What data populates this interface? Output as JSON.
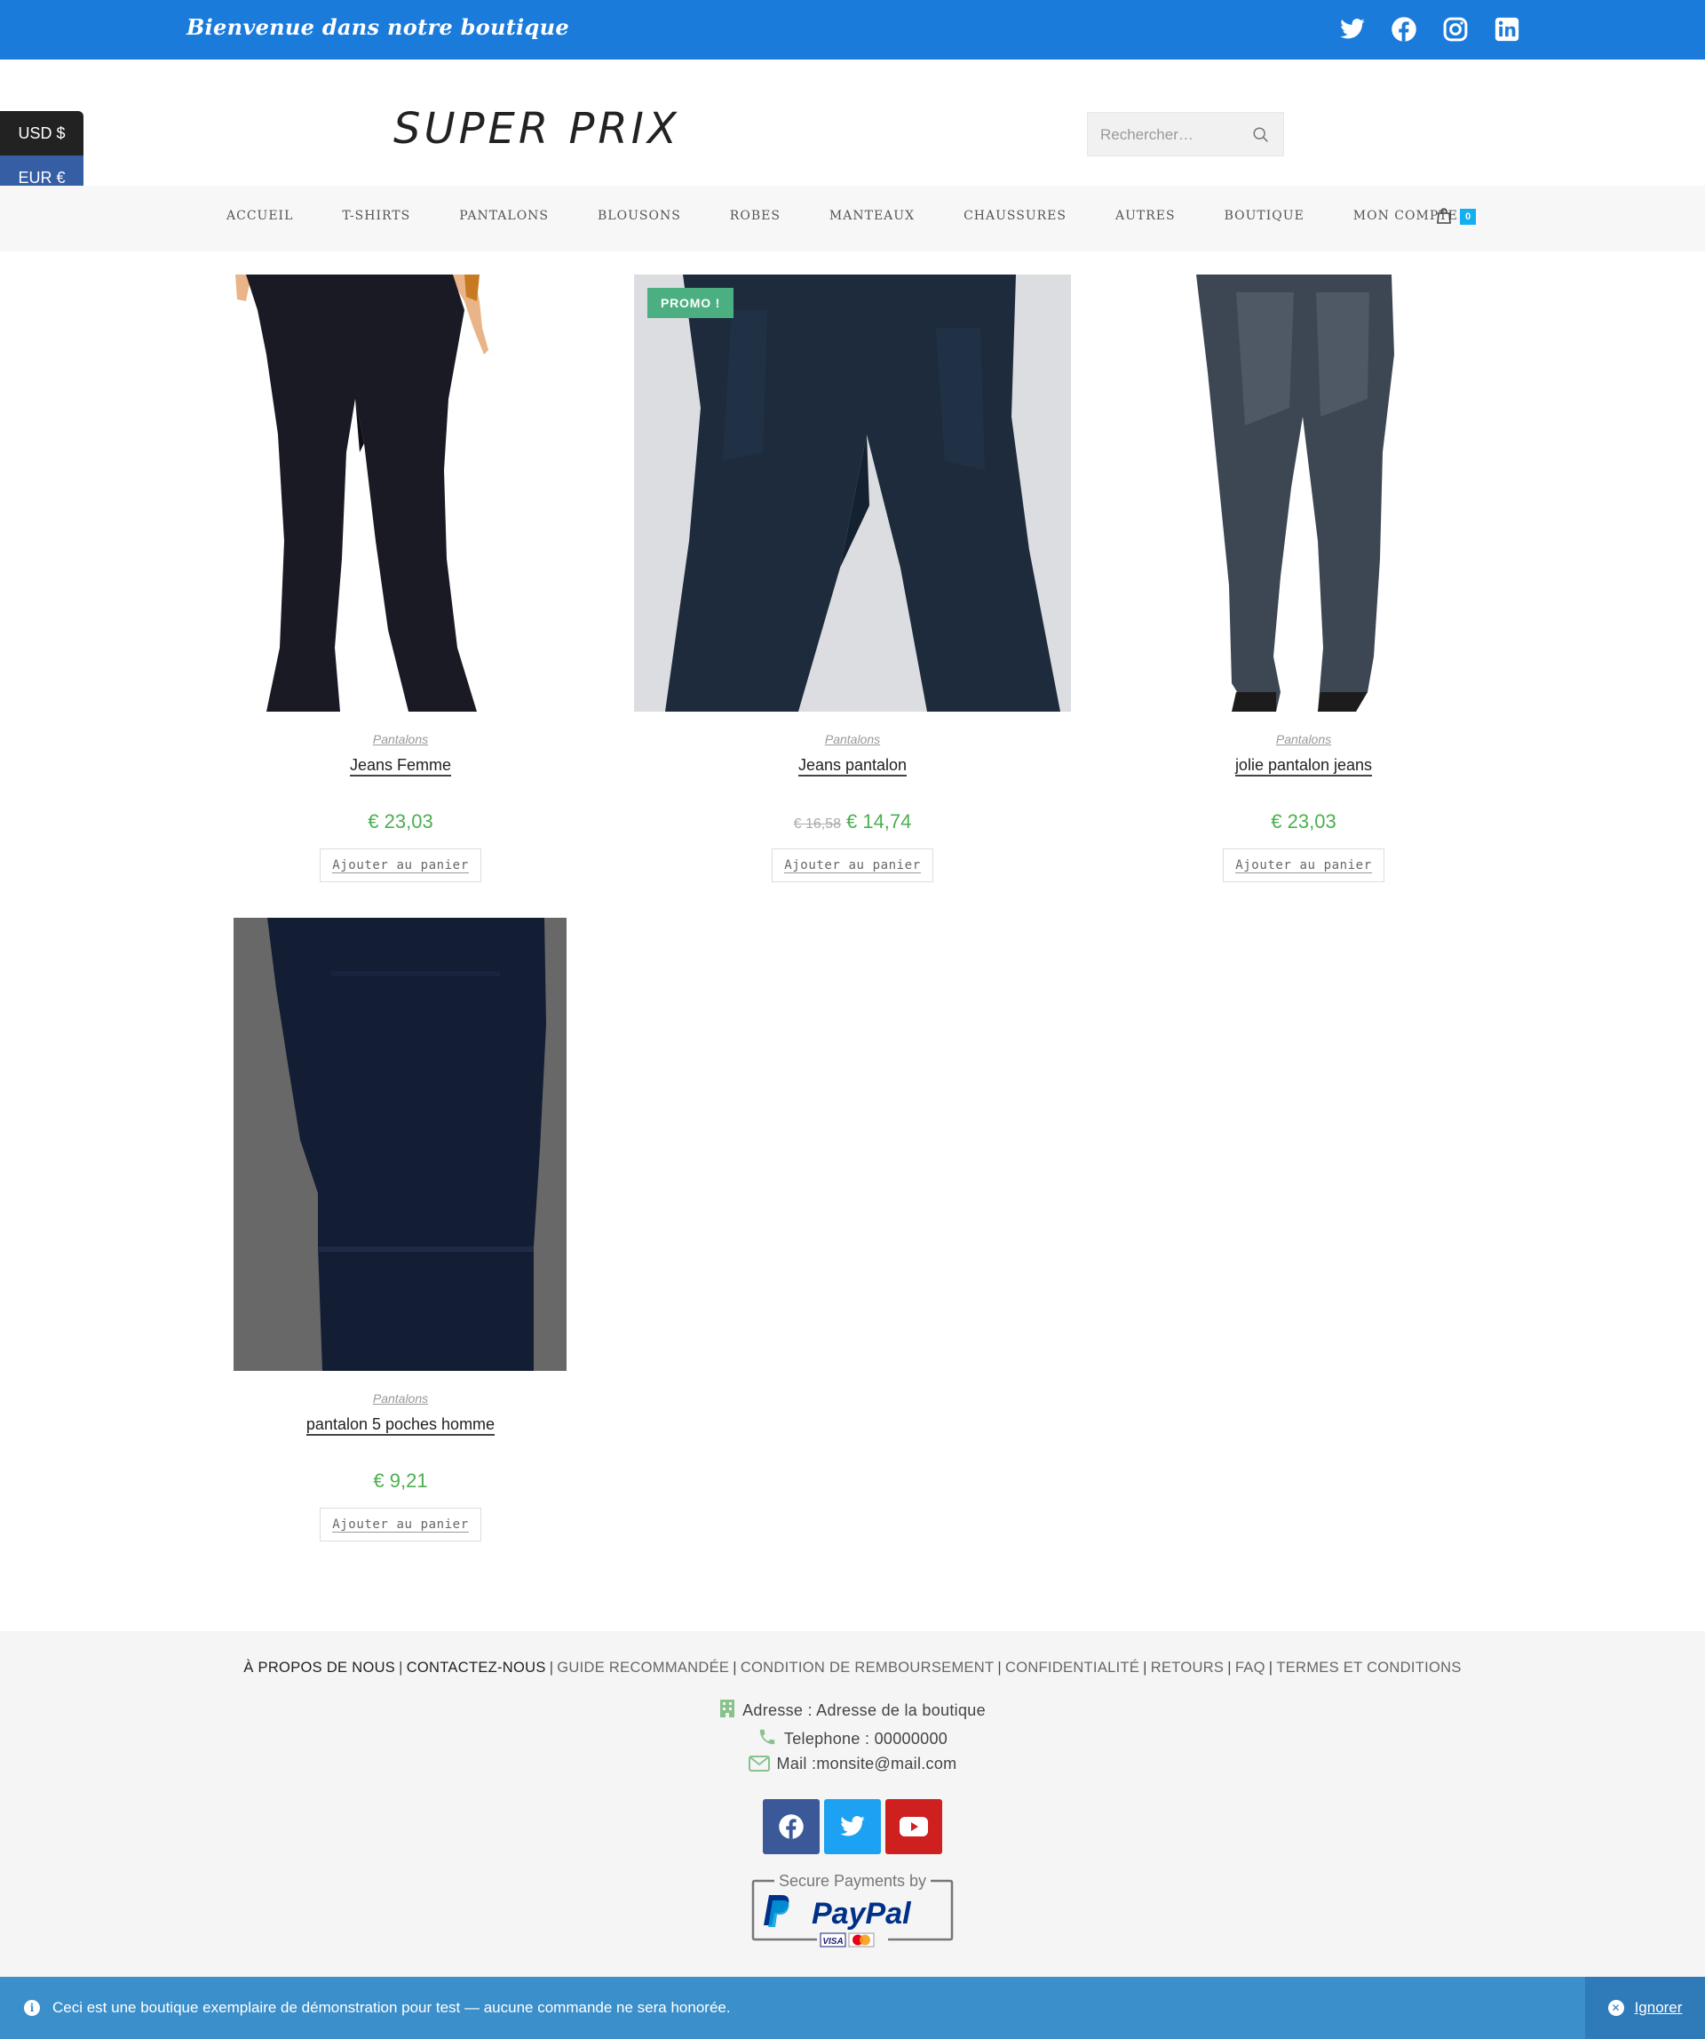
{
  "topbar": {
    "welcome": "Bienvenue dans notre boutique",
    "social_icons": [
      "twitter-icon",
      "facebook-icon",
      "instagram-icon",
      "linkedin-icon"
    ],
    "background": "#1a7bdb"
  },
  "currency": {
    "options": [
      "USD $",
      "EUR €"
    ]
  },
  "header": {
    "logo": "SUPER PRIX",
    "search_placeholder": "Rechercher…"
  },
  "nav": {
    "items": [
      "ACCUEIL",
      "T-SHIRTS",
      "PANTALONS",
      "BLOUSONS",
      "ROBES",
      "MANTEAUX",
      "CHAUSSURES",
      "AUTRES",
      "BOUTIQUE",
      "MON COMPTE"
    ],
    "cart_count": "0"
  },
  "products": [
    {
      "category": "Pantalons",
      "name": "Jeans Femme",
      "price": "€ 23,03",
      "button": "Ajouter au panier"
    },
    {
      "category": "Pantalons",
      "name": "Jeans pantalon",
      "old_price": "€ 16,58",
      "price": "€ 14,74",
      "badge": "PROMO !",
      "button": "Ajouter au panier"
    },
    {
      "category": "Pantalons",
      "name": "jolie pantalon jeans",
      "price": "€ 23,03",
      "button": "Ajouter au panier"
    },
    {
      "category": "Pantalons",
      "name": "pantalon 5 poches homme",
      "price": "€ 9,21",
      "button": "Ajouter au panier"
    }
  ],
  "footer": {
    "links": [
      "À PROPOS DE NOUS",
      "CONTACTEZ-NOUS",
      "GUIDE RECOMMANDÉE",
      "CONDITION DE REMBOURSEMENT",
      "CONFIDENTIALITÉ",
      "RETOURS",
      "FAQ",
      "TERMES ET CONDITIONS"
    ],
    "separator": "|",
    "address": "Adresse : Adresse de la boutique",
    "phone": "Telephone : 00000000",
    "mail": "Mail :monsite@mail.com",
    "social_icons": [
      "facebook-icon",
      "twitter-icon",
      "youtube-icon"
    ],
    "paypal_caption": "Secure Payments by",
    "paypal_logo": "PayPal"
  },
  "notice": {
    "text": "Ceci est une boutique exemplaire de démonstration pour test — aucune commande ne sera honorée.",
    "dismiss": "Ignorer"
  },
  "colors": {
    "accent_blue": "#1a7bdb",
    "price_green": "#4caf50",
    "promo_green": "#4caf82",
    "notice_blue": "#3b8fcb"
  }
}
